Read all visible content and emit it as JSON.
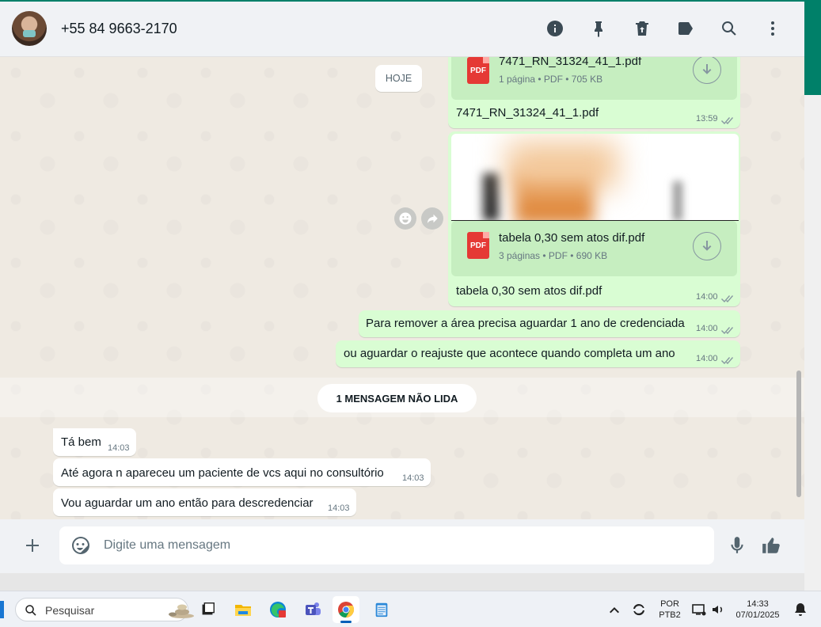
{
  "header": {
    "contact": "+55 84 9663-2170",
    "icons": [
      "info-icon",
      "pin-icon",
      "delete-icon",
      "label-icon",
      "search-icon",
      "menu-icon"
    ]
  },
  "chat": {
    "date_chip": "HOJE",
    "messages_out": [
      {
        "type": "document",
        "doc_name": "7471_RN_31324_41_1.pdf",
        "doc_meta": "1 página • PDF • 705 KB",
        "caption": "7471_RN_31324_41_1.pdf",
        "time": "13:59"
      },
      {
        "type": "document",
        "doc_name": "tabela 0,30 sem atos dif.pdf",
        "doc_meta": "3 páginas • PDF • 690 KB",
        "caption": "tabela 0,30 sem atos dif.pdf",
        "time": "14:00"
      },
      {
        "type": "text",
        "text": "Para remover a área precisa aguardar 1 ano de credenciada",
        "time": "14:00"
      },
      {
        "type": "text",
        "text": "ou aguardar o reajuste que acontece quando completa um ano",
        "time": "14:00"
      }
    ],
    "pdf_label": "PDF",
    "unread_label": "1 MENSAGEM NÃO LIDA",
    "messages_in": [
      {
        "text": "Tá bem",
        "time": "14:03"
      },
      {
        "text": "Até agora n apareceu um paciente de vcs aqui no consultório",
        "time": "14:03"
      },
      {
        "text": "Vou aguardar um ano então para descredenciar",
        "time": "14:03"
      }
    ]
  },
  "composer": {
    "placeholder": "Digite uma mensagem",
    "value": ""
  },
  "taskbar": {
    "search_label": "Pesquisar",
    "apps": [
      "task-view",
      "file-explorer",
      "edge",
      "teams",
      "chrome",
      "notepad"
    ],
    "active_app": "chrome",
    "lang_line1": "POR",
    "lang_line2": "PTB2",
    "clock_time": "14:33",
    "clock_date": "07/01/2025"
  },
  "colors": {
    "accent": "#008069",
    "bubble_out": "#d9fdd3",
    "bubble_in": "#ffffff",
    "chat_bg": "#efeae2",
    "pdf_red": "#e53935"
  }
}
